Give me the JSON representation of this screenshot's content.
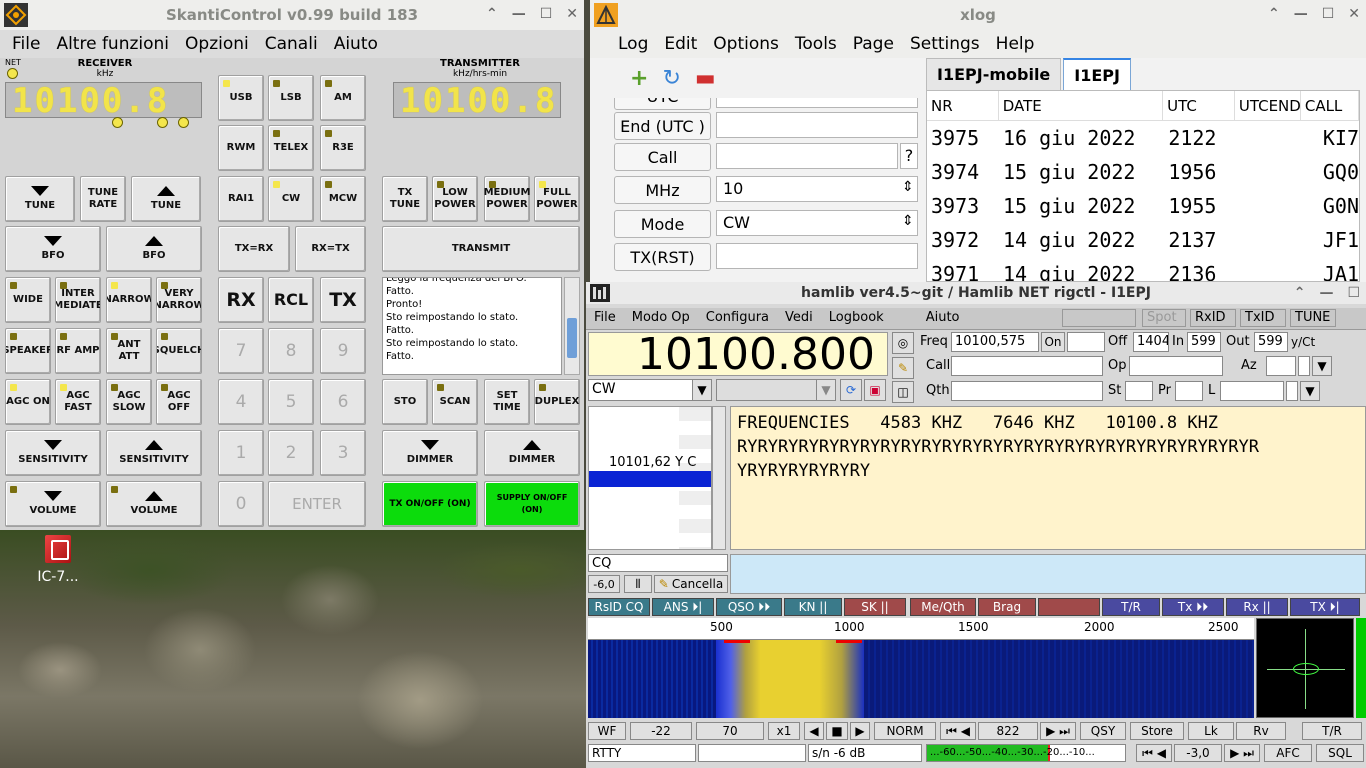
{
  "desktop": {
    "icon_label": "IC-7..."
  },
  "skanti": {
    "title": "SkantiControl v0.99 build 183",
    "menu": [
      "File",
      "Altre funzioni",
      "Opzioni",
      "Canali",
      "Aiuto"
    ],
    "net_label": "NET",
    "receiver_label": "RECEIVER",
    "receiver_unit": "kHz",
    "receiver_freq": "10100.8",
    "transmitter_label": "TRANSMITTER",
    "transmitter_unit": "kHz/hrs-min",
    "transmitter_freq": "10100.8",
    "buttons": {
      "usb": "USB",
      "lsb": "LSB",
      "am": "AM",
      "rwm": "RWM",
      "telex": "TELEX",
      "r3e": "R3E",
      "rai1": "RAI1",
      "cw": "CW",
      "mcw": "MCW",
      "tx_tune": "TX TUNE",
      "low_power": "LOW POWER",
      "medium_power": "MEDIUM POWER",
      "full_power": "FULL POWER",
      "tune_down": "TUNE",
      "tune_rate": "TUNE RATE",
      "tune_up": "TUNE",
      "bfo_down": "BFO",
      "bfo_up": "BFO",
      "tx_rx": "TX=RX",
      "rx_tx": "RX=TX",
      "transmit": "TRANSMIT",
      "wide": "WIDE",
      "intermediate": "INTER MEDIATE",
      "narrow": "NARROW",
      "very_narrow": "VERY NARROW",
      "rx": "RX",
      "rcl": "RCL",
      "tx": "TX",
      "speaker": "SPEAKER",
      "rf_amp": "RF AMP",
      "ant_att": "ANT ATT",
      "squelch": "SQUELCH",
      "agc_on": "AGC ON",
      "agc_fast": "AGC FAST",
      "agc_slow": "AGC SLOW",
      "agc_off": "AGC OFF",
      "sto": "STO",
      "scan": "SCAN",
      "set_time": "SET TIME",
      "duplex": "DUPLEX",
      "sens_down": "SENSITIVITY",
      "sens_up": "SENSITIVITY",
      "dim_down": "DIMMER",
      "dim_up": "DIMMER",
      "vol_down": "VOLUME",
      "vol_up": "VOLUME",
      "k7": "7",
      "k8": "8",
      "k9": "9",
      "k4": "4",
      "k5": "5",
      "k6": "6",
      "k1": "1",
      "k2": "2",
      "k3": "3",
      "k0": "0",
      "enter": "ENTER",
      "tx_onoff": "TX ON/OFF (ON)",
      "supply_onoff": "SUPPLY ON/OFF (ON)"
    },
    "log_lines": [
      "Leggo la frequenza del BFO.",
      "Fatto.",
      "Pronto!",
      "Sto reimpostando lo stato.",
      "Fatto.",
      "Sto reimpostando lo stato.",
      "Fatto."
    ]
  },
  "xlog": {
    "title": "xlog",
    "menu": [
      "Log",
      "Edit",
      "Options",
      "Tools",
      "Page",
      "Settings",
      "Help"
    ],
    "fields": [
      {
        "label": "UTC",
        "value": ""
      },
      {
        "label": "End (UTC )",
        "value": ""
      },
      {
        "label": "Call",
        "value": ""
      },
      {
        "label": "MHz",
        "value": "10"
      },
      {
        "label": "Mode",
        "value": "CW"
      },
      {
        "label": "TX(RST)",
        "value": ""
      }
    ],
    "call_help": "?",
    "tabs": [
      "I1EPJ-mobile",
      "I1EPJ"
    ],
    "columns": [
      "NR",
      "DATE",
      "UTC",
      "UTCEND",
      "CALL"
    ],
    "rows": [
      [
        "3975",
        "16 giu 2022",
        "2122",
        "",
        "KI7"
      ],
      [
        "3974",
        "15 giu 2022",
        "1956",
        "",
        "GQ0"
      ],
      [
        "3973",
        "15 giu 2022",
        "1955",
        "",
        "G0N"
      ],
      [
        "3972",
        "14 giu 2022",
        "2137",
        "",
        "JF1"
      ],
      [
        "3971",
        "14 giu 2022",
        "2136",
        "",
        "JA1"
      ]
    ]
  },
  "fldigi": {
    "title": "hamlib ver4.5~git / Hamlib NET rigctl - I1EPJ",
    "menu": [
      "File",
      "Modo Op",
      "Configura",
      "Vedi",
      "Logbook",
      "Aiuto"
    ],
    "spot": "Spot",
    "rxid": "RxID",
    "txid": "TxID",
    "tune": "TUNE",
    "freq_display": "10100.800",
    "mode": "CW",
    "labels": {
      "freq": "Freq",
      "on": "On",
      "off": "Off",
      "in": "In",
      "out": "Out",
      "call": "Call",
      "op": "Op",
      "az": "Az",
      "qth": "Qth",
      "st": "St",
      "pr": "Pr",
      "l": "L",
      "yct": "y/Ct"
    },
    "values": {
      "freq": "10100,575",
      "off": "1404",
      "in": "599",
      "out": "599"
    },
    "signal_list": "10101,62 Y C",
    "rx_text": "FREQUENCIES   4583 KHZ   7646 KHZ   10100.8 KHZ\nRYRYRYRYRYRYRYRYRYRYRYRYRYRYRYRYRYRYRYRYRYRYRYRYRYR\nYRYRYRYRYRYRY",
    "cq": "CQ",
    "level": "-6,0",
    "clear": "Cancella",
    "macros": [
      "RsID CQ",
      "ANS ⏵|",
      "QSO ⏵⏵",
      "KN ||",
      "SK ||",
      "Me/Qth",
      "Brag",
      "",
      "T/R",
      "Tx ⏵⏵",
      "Rx ||",
      "TX ⏵|"
    ],
    "scale": [
      "500",
      "1000",
      "1500",
      "2000",
      "2500"
    ],
    "bottom": {
      "wf": "WF",
      "low": "-22",
      "range": "70",
      "zoom": "x1",
      "norm": "NORM",
      "carrier": "822",
      "qsy": "QSY",
      "store": "Store",
      "lk": "Lk",
      "rv": "Rv",
      "tr": "T/R"
    },
    "status": {
      "mode": "RTTY",
      "sn": "s/n -6  dB",
      "meter": "...-60...-50...-40...-30...-20...-10...",
      "sql_level": "-3,0",
      "afc": "AFC",
      "sql": "SQL"
    }
  }
}
